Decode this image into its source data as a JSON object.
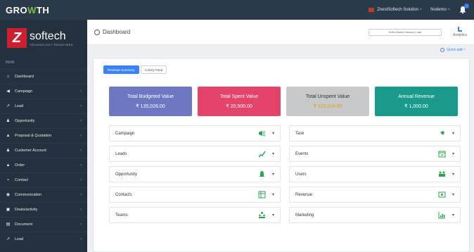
{
  "app": {
    "brand_pre": "GRO",
    "brand_mid": "W",
    "brand_post": "TH"
  },
  "topbar": {
    "org_name": "ZnestSoftech Solution ~",
    "user_name": "Nodemo ~"
  },
  "sidebar": {
    "logo_mark": "Z",
    "logo_name": "softech",
    "logo_tag": "TECHNOLOGY REDEFINED",
    "menu_label": "MAIN",
    "items": [
      {
        "label": "Dashboard",
        "icon": "home-icon"
      },
      {
        "label": "Campaign",
        "icon": "megaphone-icon"
      },
      {
        "label": "Lead",
        "icon": "chart-icon"
      },
      {
        "label": "Opportunity",
        "icon": "bell-icon"
      },
      {
        "label": "Proposal & Quotation",
        "icon": "document-icon"
      },
      {
        "label": "Customer Account",
        "icon": "user-icon"
      },
      {
        "label": "Order",
        "icon": "cart-icon"
      },
      {
        "label": "Contact",
        "icon": "contact-icon"
      },
      {
        "label": "Communication",
        "icon": "chat-icon"
      },
      {
        "label": "Deals/activity",
        "icon": "deal-icon"
      },
      {
        "label": "Document",
        "icon": "doc-icon"
      },
      {
        "label": "Lead",
        "icon": "lead-icon"
      }
    ]
  },
  "header": {
    "title": "Dashboard",
    "select_label": "Edit's Added Various Load",
    "analytics_label": "Analytics"
  },
  "quick_add": "Quick add ~",
  "tabs": [
    {
      "label": "Revenue Summary",
      "active": true
    },
    {
      "label": "Activity Feed",
      "active": false
    }
  ],
  "cards": [
    {
      "label": "Total Budgeted Value",
      "value": "₹ 135,026.00",
      "color": "#6e78c2"
    },
    {
      "label": "Total Spent Value",
      "value": "₹ 20,500.00",
      "color": "#e4436a"
    },
    {
      "label": "Total Unspent Value",
      "value": "₹ 115,318.00",
      "color": "#c8c9cb"
    },
    {
      "label": "Annual Revenue",
      "value": "₹ 1,000.00",
      "color": "#1a9a8b"
    }
  ],
  "rows_left": [
    {
      "label": "Campaign",
      "icon": "megaphone-icon",
      "color": "#2ea44f"
    },
    {
      "label": "Leads",
      "icon": "chart-up-icon",
      "color": "#2ea44f"
    },
    {
      "label": "Opportunity",
      "icon": "bell-icon",
      "color": "#2ea44f"
    },
    {
      "label": "Contacts",
      "icon": "table-icon",
      "color": "#2ea44f"
    },
    {
      "label": "Teams",
      "icon": "team-icon",
      "color": "#2ea44f"
    }
  ],
  "rows_right": [
    {
      "label": "Task",
      "icon": "pin-icon",
      "color": "#2ea44f"
    },
    {
      "label": "Events",
      "icon": "calendar-icon",
      "color": "#2ea44f"
    },
    {
      "label": "Users",
      "icon": "users-icon",
      "color": "#2ea44f"
    },
    {
      "label": "Revenue",
      "icon": "money-icon",
      "color": "#2ea44f"
    },
    {
      "label": "Marketing",
      "icon": "bar-chart-icon",
      "color": "#2ea44f"
    }
  ],
  "dropdown_glyph": "▾"
}
